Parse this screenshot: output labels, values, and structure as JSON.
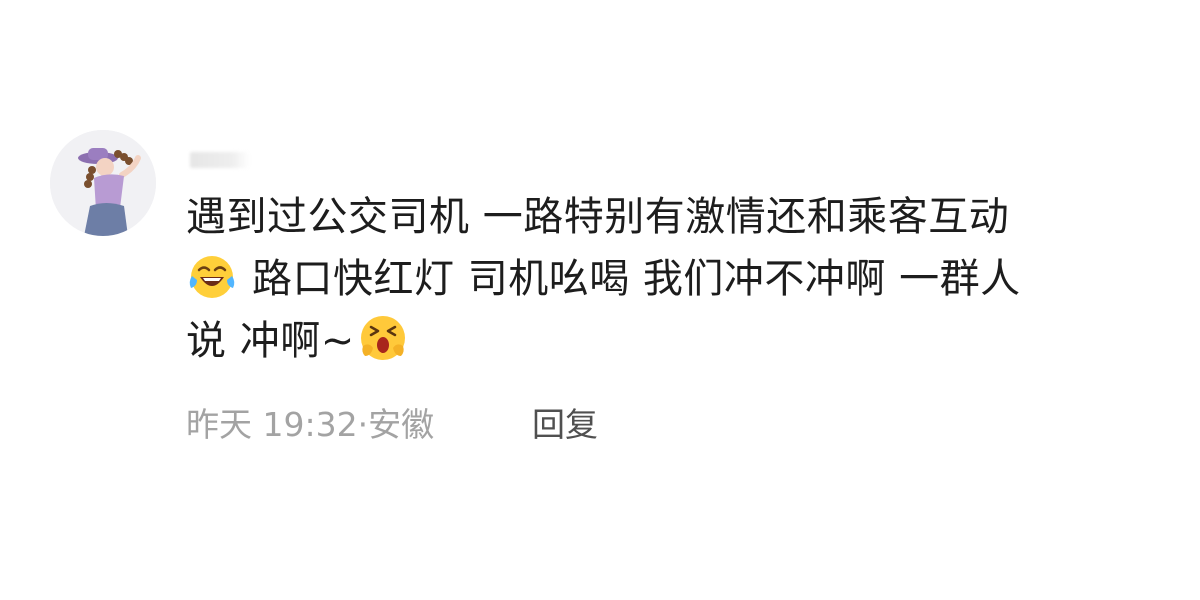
{
  "comment": {
    "avatar_icon": "woman-avatar-icon",
    "lines": {
      "line1": "遇到过公交司机 一路特别有激情还和乘客互动",
      "line2_emoji": "laughing-tears-emoji",
      "line2_text": "路口快红灯  司机吆喝 我们冲不冲啊 一群人",
      "line3_text": "说 冲啊~",
      "line3_emoji": "shouting-face-emoji"
    },
    "meta": {
      "time": "昨天 19:32",
      "separator": "·",
      "location": "安徽"
    },
    "reply_label": "回复"
  },
  "colors": {
    "text": "#1d1d1d",
    "meta": "#a3a3a3",
    "reply": "#505050",
    "background": "#ffffff"
  }
}
